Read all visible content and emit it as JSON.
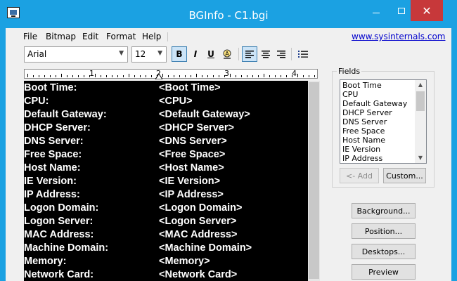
{
  "window": {
    "title": "BGInfo - C1.bgi",
    "minimize": "–",
    "close": "✕"
  },
  "menu": {
    "items": [
      "File",
      "Bitmap",
      "Edit",
      "Format",
      "Help"
    ],
    "link": "www.sysinternals.com"
  },
  "toolbar": {
    "font": "Arial",
    "size": "12",
    "bold": "B",
    "italic": "I",
    "underline": "U",
    "font_color": "color-picker-icon",
    "align_left": "align-left-icon",
    "align_center": "align-center-icon",
    "align_right": "align-right-icon",
    "bullets": "bullet-list-icon"
  },
  "ruler": {
    "numbers": [
      "1",
      "2",
      "3",
      "4"
    ]
  },
  "editor": {
    "rows": [
      {
        "label": "Boot Time:",
        "value": "<Boot Time>"
      },
      {
        "label": "CPU:",
        "value": "<CPU>"
      },
      {
        "label": "Default Gateway:",
        "value": "<Default Gateway>"
      },
      {
        "label": "DHCP Server:",
        "value": "<DHCP Server>"
      },
      {
        "label": "DNS Server:",
        "value": "<DNS Server>"
      },
      {
        "label": "Free Space:",
        "value": "<Free Space>"
      },
      {
        "label": "Host Name:",
        "value": "<Host Name>"
      },
      {
        "label": "IE Version:",
        "value": "<IE Version>"
      },
      {
        "label": "IP Address:",
        "value": "<IP Address>"
      },
      {
        "label": "Logon Domain:",
        "value": "<Logon Domain>"
      },
      {
        "label": "Logon Server:",
        "value": "<Logon Server>"
      },
      {
        "label": "MAC Address:",
        "value": "<MAC Address>"
      },
      {
        "label": "Machine Domain:",
        "value": "<Machine Domain>"
      },
      {
        "label": "Memory:",
        "value": "<Memory>"
      },
      {
        "label": "Network Card:",
        "value": "<Network Card>"
      }
    ]
  },
  "fields": {
    "legend": "Fields",
    "items": [
      "Boot Time",
      "CPU",
      "Default Gateway",
      "DHCP Server",
      "DNS Server",
      "Free Space",
      "Host Name",
      "IE Version",
      "IP Address"
    ],
    "add_label": "<- Add",
    "custom_label": "Custom..."
  },
  "buttons": {
    "background": "Background...",
    "position": "Position...",
    "desktops": "Desktops...",
    "preview": "Preview"
  },
  "colors": {
    "titlebar": "#1ba1e2",
    "close": "#c7383a",
    "editor_bg": "#000000",
    "editor_text": "#ffffff",
    "link": "#0000cc"
  }
}
